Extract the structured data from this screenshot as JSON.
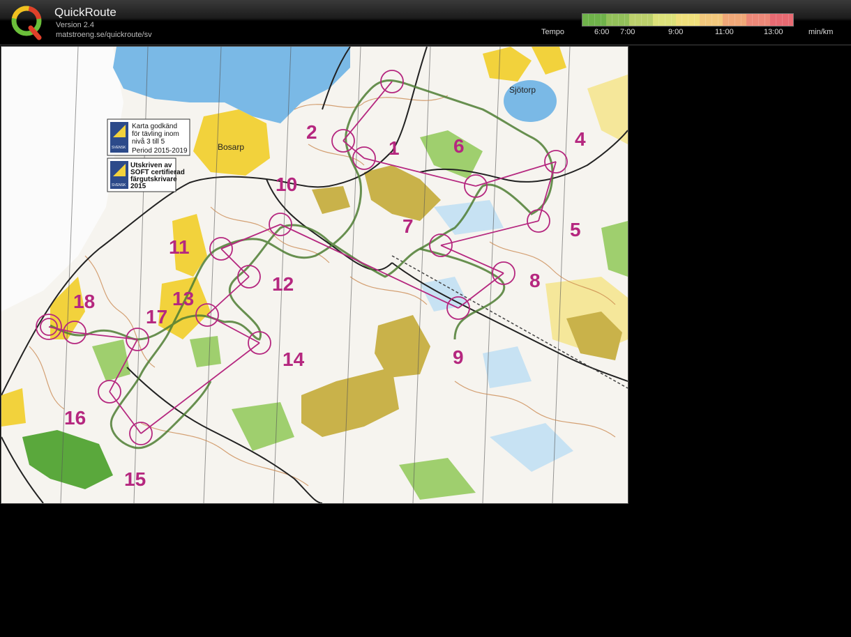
{
  "app": {
    "title": "QuickRoute",
    "version": "Version 2.4",
    "url": "matstroeng.se/quickroute/sv"
  },
  "tempo": {
    "label": "Tempo",
    "ticks": [
      "6:00",
      "7:00",
      "9:00",
      "11:00",
      "13:00"
    ],
    "unit": "min/km",
    "gradient_colors": [
      "#6fb24a",
      "#93c05a",
      "#bcd06c",
      "#dde27a",
      "#f0e07c",
      "#f2c87c",
      "#f0a878",
      "#ec8878",
      "#e86a72"
    ]
  },
  "map": {
    "place_labels": [
      "Bosarp",
      "Sjötorp"
    ],
    "notice_approved": {
      "logo_text": "SVENSK",
      "lines": [
        "Karta godkänd",
        "för tävling inom",
        "nivå 3 till 5",
        "Period 2015-2019"
      ]
    },
    "notice_printed": {
      "logo_text": "SVENSK",
      "lines": [
        "Utskriven av",
        "SOFT certifierad",
        "färgutskrivare",
        "2015"
      ]
    },
    "controls": [
      "1",
      "2",
      "4",
      "5",
      "6",
      "7",
      "8",
      "9",
      "10",
      "11",
      "12",
      "13",
      "14",
      "15",
      "16",
      "17",
      "18"
    ],
    "colors": {
      "water": "#7ab9e6",
      "open_land": "#f2d23c",
      "rough_open": "#f5e79a",
      "green": "#9fcf6e",
      "dark_green": "#5aa83c",
      "course": "#b5277f",
      "route": "#4e7d33",
      "contour": "#c8844a"
    }
  }
}
